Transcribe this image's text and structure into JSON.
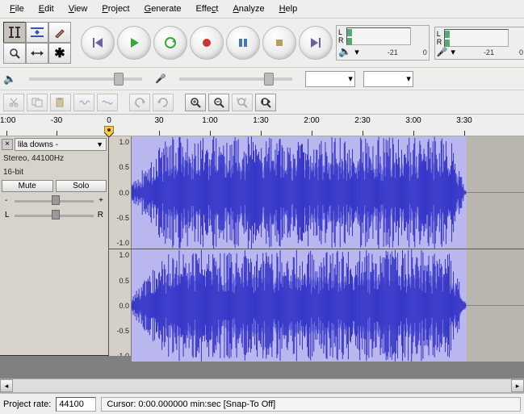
{
  "menu": {
    "file": "File",
    "edit": "Edit",
    "view": "View",
    "project": "Project",
    "generate": "Generate",
    "effect": "Effect",
    "analyze": "Analyze",
    "help": "Help"
  },
  "meters": {
    "left_lr": {
      "l": "L",
      "r": "R"
    },
    "scale": {
      "a": "-21",
      "b": "0"
    }
  },
  "timeline": {
    "t0": "-1:00",
    "t1": "-30",
    "t2": "0",
    "t3": "30",
    "t4": "1:00",
    "t5": "1:30",
    "t6": "2:00",
    "t7": "2:30",
    "t8": "3:00",
    "t9": "3:30"
  },
  "track": {
    "name": "lila downs - ",
    "format": "Stereo, 44100Hz",
    "depth": "16-bit",
    "mute": "Mute",
    "solo": "Solo",
    "gain": {
      "minus": "-",
      "plus": "+"
    },
    "pan": {
      "l": "L",
      "r": "R"
    },
    "scale": {
      "p10": "1.0",
      "p05": "0.5",
      "z": "0.0",
      "n05": "-0.5",
      "n10": "-1.0"
    }
  },
  "status": {
    "rate_label": "Project rate:",
    "rate_value": "44100",
    "cursor": "Cursor: 0:00.000000 min:sec   [Snap-To Off]"
  },
  "chart_data": {
    "type": "waveform",
    "channels": 2,
    "sample_rate_hz": 44100,
    "bit_depth": 16,
    "duration_sec": 195,
    "y_range": [
      -1.0,
      1.0
    ],
    "note": "Dense stereo audio waveform filling full amplitude range with RMS envelope roughly ±0.4 to ±0.6, peaks to ±1.0 throughout; slight taper near end."
  }
}
